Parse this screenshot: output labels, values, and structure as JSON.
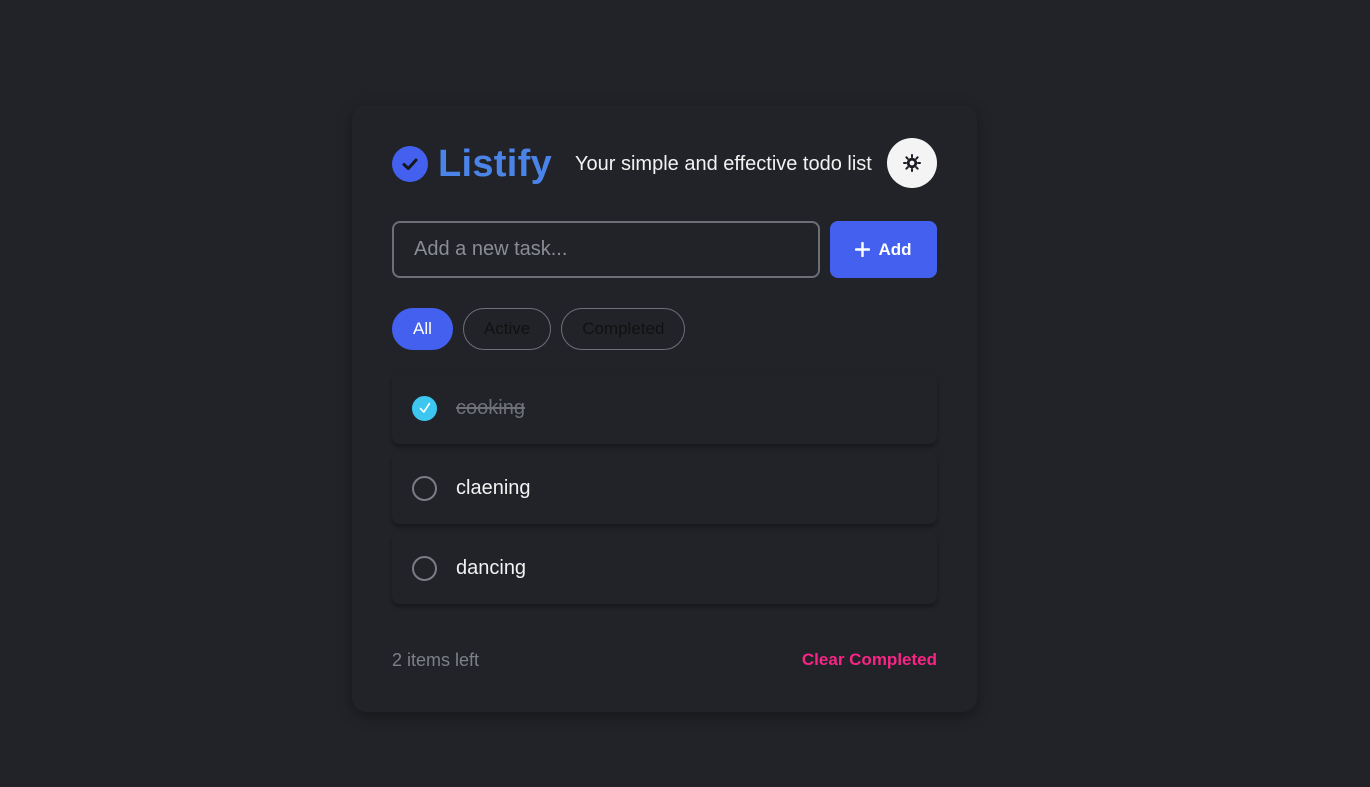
{
  "app": {
    "title": "Listify",
    "tagline": "Your simple and effective todo list",
    "logo_icon": "check-circle-icon",
    "theme_icon": "sun-icon"
  },
  "input": {
    "placeholder": "Add a new task...",
    "value": "",
    "add_label": "Add",
    "add_icon": "plus-icon"
  },
  "filters": [
    {
      "label": "All",
      "active": true
    },
    {
      "label": "Active",
      "active": false
    },
    {
      "label": "Completed",
      "active": false
    }
  ],
  "todos": [
    {
      "text": "cooking",
      "completed": true
    },
    {
      "text": "claening",
      "completed": false
    },
    {
      "text": "dancing",
      "completed": false
    }
  ],
  "footer": {
    "items_left": "2 items left",
    "clear_label": "Clear Completed"
  },
  "colors": {
    "accent": "#4361ee",
    "title": "#4b84e8",
    "check": "#3cc6f0",
    "danger": "#f72585",
    "background": "#212328"
  }
}
